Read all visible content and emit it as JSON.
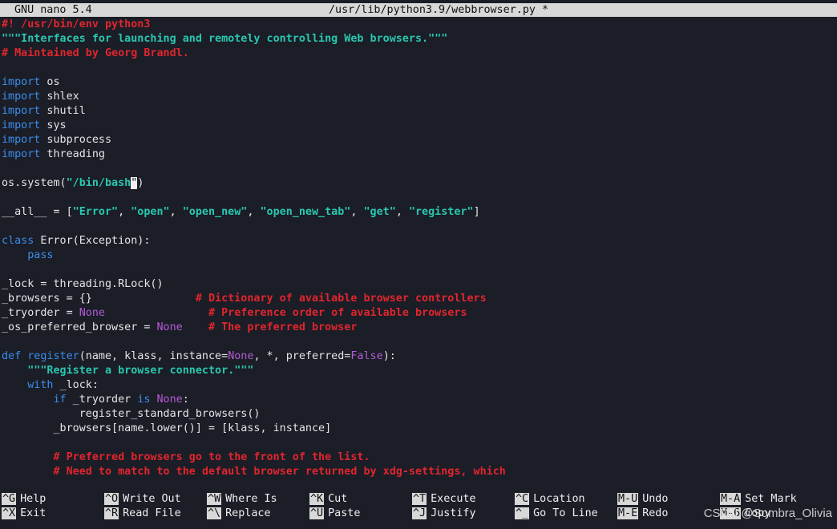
{
  "titlebar": {
    "app_version": "GNU nano 5.4",
    "file_path": "/usr/lib/python3.9/webbrowser.py *"
  },
  "code_lines": [
    [
      {
        "t": "#! /usr/bin/env python3",
        "c": "cmt"
      }
    ],
    [
      {
        "t": "\"\"\"Interfaces for launching and remotely controlling Web browsers.\"\"\"",
        "c": "str"
      }
    ],
    [
      {
        "t": "# Maintained by Georg Brandl.",
        "c": "cmt"
      }
    ],
    [],
    [
      {
        "t": "import",
        "c": "kw"
      },
      {
        "t": " os",
        "c": "id"
      }
    ],
    [
      {
        "t": "import",
        "c": "kw"
      },
      {
        "t": " shlex",
        "c": "id"
      }
    ],
    [
      {
        "t": "import",
        "c": "kw"
      },
      {
        "t": " shutil",
        "c": "id"
      }
    ],
    [
      {
        "t": "import",
        "c": "kw"
      },
      {
        "t": " sys",
        "c": "id"
      }
    ],
    [
      {
        "t": "import",
        "c": "kw"
      },
      {
        "t": " subprocess",
        "c": "id"
      }
    ],
    [
      {
        "t": "import",
        "c": "kw"
      },
      {
        "t": " threading",
        "c": "id"
      }
    ],
    [],
    [
      {
        "t": "os.system(",
        "c": "id"
      },
      {
        "t": "\"/bin/bash",
        "c": "str"
      },
      {
        "t": "\"",
        "c": "cursor"
      },
      {
        "t": ")",
        "c": "id"
      }
    ],
    [],
    [
      {
        "t": "__all__ = [",
        "c": "id"
      },
      {
        "t": "\"Error\"",
        "c": "str"
      },
      {
        "t": ", ",
        "c": "id"
      },
      {
        "t": "\"open\"",
        "c": "str"
      },
      {
        "t": ", ",
        "c": "id"
      },
      {
        "t": "\"open_new\"",
        "c": "str"
      },
      {
        "t": ", ",
        "c": "id"
      },
      {
        "t": "\"open_new_tab\"",
        "c": "str"
      },
      {
        "t": ", ",
        "c": "id"
      },
      {
        "t": "\"get\"",
        "c": "str"
      },
      {
        "t": ", ",
        "c": "id"
      },
      {
        "t": "\"register\"",
        "c": "str"
      },
      {
        "t": "]",
        "c": "id"
      }
    ],
    [],
    [
      {
        "t": "class",
        "c": "kw"
      },
      {
        "t": " Error(Exception):",
        "c": "id"
      }
    ],
    [
      {
        "t": "    ",
        "c": "id"
      },
      {
        "t": "pass",
        "c": "kw"
      }
    ],
    [],
    [
      {
        "t": "_lock = threading.RLock()",
        "c": "id"
      }
    ],
    [
      {
        "t": "_browsers = {}                ",
        "c": "id"
      },
      {
        "t": "# Dictionary of available browser controllers",
        "c": "cmt"
      }
    ],
    [
      {
        "t": "_tryorder = ",
        "c": "id"
      },
      {
        "t": "None",
        "c": "const"
      },
      {
        "t": "                ",
        "c": "id"
      },
      {
        "t": "# Preference order of available browsers",
        "c": "cmt"
      }
    ],
    [
      {
        "t": "_os_preferred_browser = ",
        "c": "id"
      },
      {
        "t": "None",
        "c": "const"
      },
      {
        "t": "    ",
        "c": "id"
      },
      {
        "t": "# The preferred browser",
        "c": "cmt"
      }
    ],
    [],
    [
      {
        "t": "def",
        "c": "kw"
      },
      {
        "t": " ",
        "c": "id"
      },
      {
        "t": "register",
        "c": "kw"
      },
      {
        "t": "(name, klass, instance=",
        "c": "id"
      },
      {
        "t": "None",
        "c": "const"
      },
      {
        "t": ", *, preferred=",
        "c": "id"
      },
      {
        "t": "False",
        "c": "const"
      },
      {
        "t": "):",
        "c": "id"
      }
    ],
    [
      {
        "t": "    ",
        "c": "id"
      },
      {
        "t": "\"\"\"Register a browser connector.\"\"\"",
        "c": "str"
      }
    ],
    [
      {
        "t": "    ",
        "c": "id"
      },
      {
        "t": "with",
        "c": "kw"
      },
      {
        "t": " _lock:",
        "c": "id"
      }
    ],
    [
      {
        "t": "        ",
        "c": "id"
      },
      {
        "t": "if",
        "c": "kw"
      },
      {
        "t": " _tryorder ",
        "c": "id"
      },
      {
        "t": "is",
        "c": "kw"
      },
      {
        "t": " ",
        "c": "id"
      },
      {
        "t": "None",
        "c": "const"
      },
      {
        "t": ":",
        "c": "id"
      }
    ],
    [
      {
        "t": "            register_standard_browsers()",
        "c": "id"
      }
    ],
    [
      {
        "t": "        _browsers[name.lower()] = [klass, instance]",
        "c": "id"
      }
    ],
    [],
    [
      {
        "t": "        ",
        "c": "id"
      },
      {
        "t": "# Preferred browsers go to the front of the list.",
        "c": "cmt"
      }
    ],
    [
      {
        "t": "        ",
        "c": "id"
      },
      {
        "t": "# Need to match to the default browser returned by xdg-settings, which",
        "c": "cmt"
      }
    ]
  ],
  "shortcuts": [
    {
      "key": "^G",
      "label": "Help"
    },
    {
      "key": "^O",
      "label": "Write Out"
    },
    {
      "key": "^W",
      "label": "Where Is"
    },
    {
      "key": "^K",
      "label": "Cut"
    },
    {
      "key": "^T",
      "label": "Execute"
    },
    {
      "key": "^C",
      "label": "Location"
    },
    {
      "key": "M-U",
      "label": "Undo"
    },
    {
      "key": "M-A",
      "label": "Set Mark"
    },
    {
      "key": "^X",
      "label": "Exit"
    },
    {
      "key": "^R",
      "label": "Read File"
    },
    {
      "key": "^\\",
      "label": "Replace"
    },
    {
      "key": "^U",
      "label": "Paste"
    },
    {
      "key": "^J",
      "label": "Justify"
    },
    {
      "key": "^_",
      "label": "Go To Line"
    },
    {
      "key": "M-E",
      "label": "Redo"
    },
    {
      "key": "M-6",
      "label": "Copy"
    }
  ],
  "watermark": "CSDN @Sombra_Olivia"
}
